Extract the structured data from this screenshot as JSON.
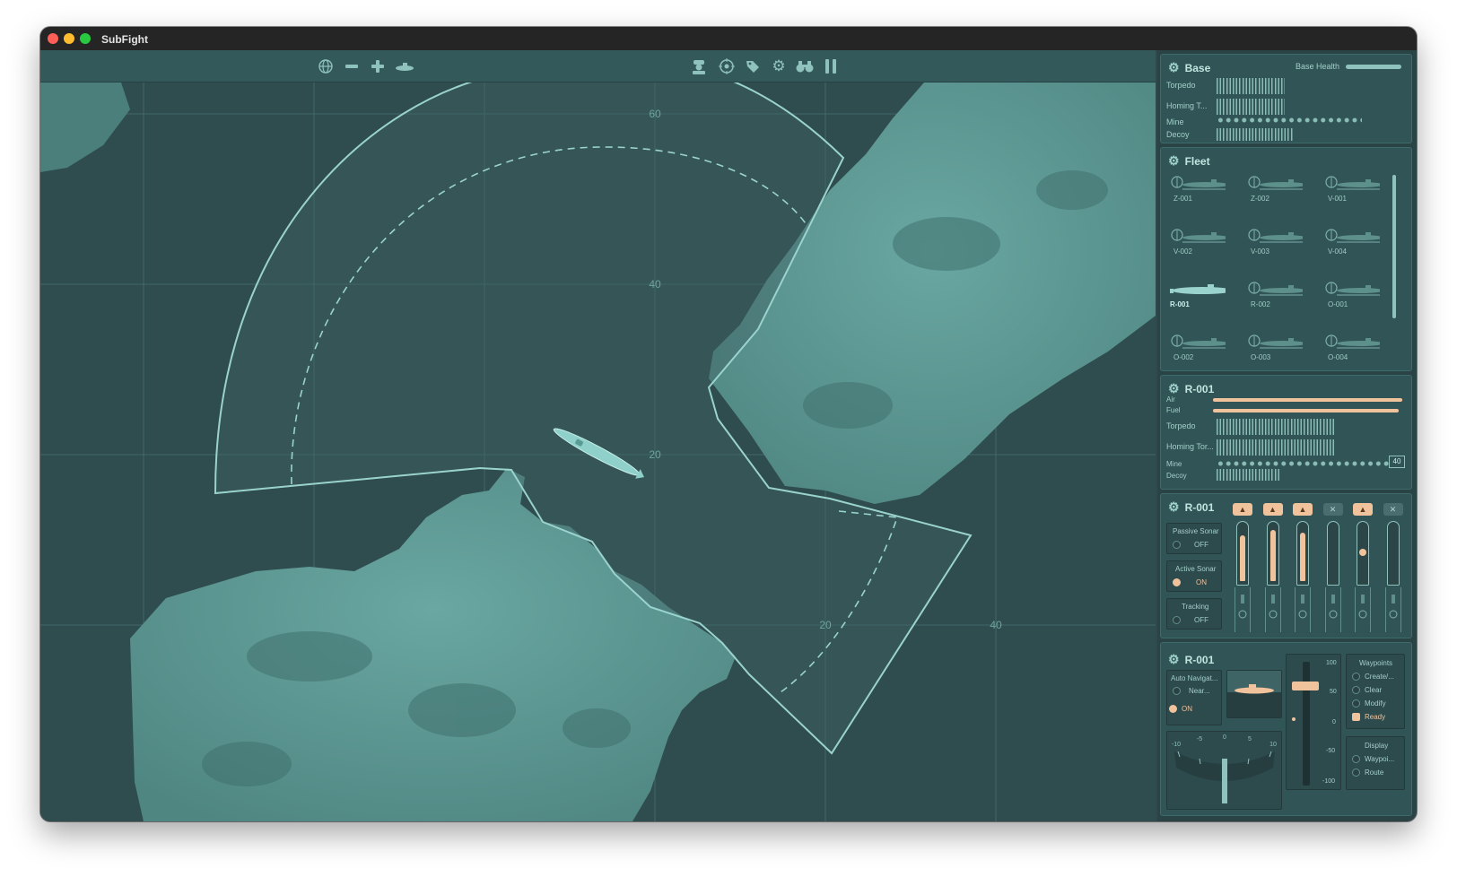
{
  "app": {
    "title": "SubFight"
  },
  "map": {
    "grid_labels": [
      "60",
      "40",
      "20",
      "20",
      "40",
      "20"
    ]
  },
  "base": {
    "title": "Base",
    "health_label": "Base Health",
    "health": 1.0,
    "rows": [
      "Torpedo",
      "Homing T...",
      "Mine",
      "Decoy"
    ]
  },
  "fleet": {
    "title": "Fleet",
    "ships": [
      "Z-001",
      "Z-002",
      "V-001",
      "V-002",
      "V-003",
      "V-004",
      "R-001",
      "R-002",
      "O-001",
      "O-002",
      "O-003",
      "O-004"
    ],
    "selected": "R-001"
  },
  "status": {
    "title": "R-001",
    "air_label": "Air",
    "fuel_label": "Fuel",
    "air": 1.0,
    "fuel": 0.98,
    "rows": [
      "Torpedo",
      "Homing Tor...",
      "Mine",
      "Decoy"
    ],
    "mine_count": "40"
  },
  "sonar": {
    "title": "R-001",
    "passive": {
      "label": "Passive Sonar",
      "value": "OFF"
    },
    "active": {
      "label": "Active Sonar",
      "value": "ON"
    },
    "tracking": {
      "label": "Tracking",
      "value": "OFF"
    }
  },
  "nav": {
    "title": "R-001",
    "auto_nav": {
      "label": "Auto Navigat...",
      "option": "Near...",
      "value": "ON"
    },
    "gauge_labels": [
      "-10",
      "-5",
      "0",
      "5",
      "10"
    ],
    "depth_labels": [
      "100",
      "50",
      "0",
      "-50",
      "-100"
    ],
    "waypoints": {
      "title": "Waypoints",
      "items": [
        "Create/...",
        "Clear",
        "Modify",
        "Ready"
      ]
    },
    "display": {
      "title": "Display",
      "items": [
        "Waypoi...",
        "Route"
      ]
    }
  },
  "colors": {
    "accent": "#f0c39d",
    "panel": "#315456",
    "land": "#5d9894",
    "line": "#9ad3cd"
  }
}
